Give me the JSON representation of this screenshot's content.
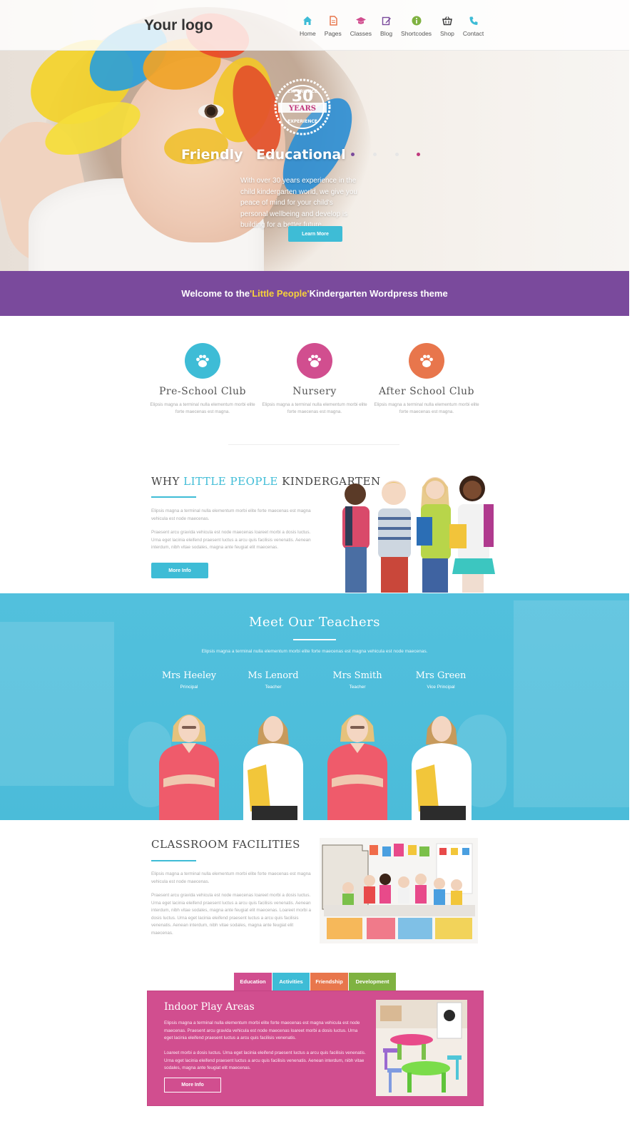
{
  "header": {
    "logo": "Your logo",
    "nav": [
      {
        "label": "Home",
        "icon": "home-icon",
        "color": "#3ebcd6"
      },
      {
        "label": "Pages",
        "icon": "document-icon",
        "color": "#e8764c"
      },
      {
        "label": "Classes",
        "icon": "graduation-cap-icon",
        "color": "#d14e8f"
      },
      {
        "label": "Blog",
        "icon": "edit-icon",
        "color": "#7a4a9c"
      },
      {
        "label": "Shortcodes",
        "icon": "info-icon",
        "color": "#7fb241"
      },
      {
        "label": "Shop",
        "icon": "basket-icon",
        "color": "#333333"
      },
      {
        "label": "Contact",
        "icon": "phone-icon",
        "color": "#3ebcd6"
      }
    ]
  },
  "hero": {
    "badge_number": "30",
    "badge_top": "EXPERIENCE",
    "badge_mid": "YEARS",
    "badge_bottom": "EXPERIENCE",
    "word_left": "Friendly",
    "word_right": "Educational",
    "text": "With over 30 years experience in the child kindergarten world, we give you peace of mind for your child's personal wellbeing and develop is building for a better future.",
    "button": "Learn More",
    "dot_colors": [
      "#7a4a9c",
      "#e6e6e6",
      "#e6e6e6",
      "#c0397d"
    ]
  },
  "welcome": {
    "prefix": "Welcome to the ",
    "highlight": "'Little People'",
    "suffix": " Kindergarten Wordpress theme"
  },
  "clubs": [
    {
      "title": "Pre-School Club",
      "color": "#3ebcd6",
      "icon": "paw-icon",
      "text": "Elipsis magna a terminal nulla elementum morbi elite forte maecenas est magna."
    },
    {
      "title": "Nursery",
      "color": "#d14e8f",
      "icon": "paw-icon",
      "text": "Elipsis magna a terminal nulla elementum morbi elite forte maecenas est magna."
    },
    {
      "title": "After School Club",
      "color": "#e8764c",
      "icon": "paw-icon",
      "text": "Elipsis magna a terminal nulla elementum morbi elite forte maecenas est magna."
    }
  ],
  "why": {
    "title_pre": "WHY ",
    "title_accent": "LITTLE PEOPLE",
    "title_post": " KINDERGARTEN",
    "p1": "Elipsis magna a terminal nulla elementum morbi elite forte maecenas est magna vehicula est node maecenas.",
    "p2": "Praesent arcu gravida vehicula est node maecenas loareet morbi a dosis luctus. Urna eget lacinia eleifend praesent luctus a arcu quis facilisis venenatis. Aenean interdum, nibh vitae sodales, magna ante feugiat elit maecenas.",
    "button": "More Info"
  },
  "teachers": {
    "title": "Meet Our Teachers",
    "subtitle": "Elipsis magna a terminal nulla elementum morbi elite forte maecenas est magna vehicula est node maecenas.",
    "list": [
      {
        "name": "Mrs Heeley",
        "role": "Principal"
      },
      {
        "name": "Ms Lenord",
        "role": "Teacher"
      },
      {
        "name": "Mrs Smith",
        "role": "Teacher"
      },
      {
        "name": "Mrs Green",
        "role": "Vice Principal"
      }
    ]
  },
  "classroom": {
    "title": "CLASSROOM FACILITIES",
    "p1": "Elipsis magna a terminal nulla elementum morbi elite forte maecenas est magna vehicula est node maecenas.",
    "p2": "Praesent arcu gravida vehicula est node maecenas loareet morbi a dosis luctus. Urna eget lacinia eleifend praesent luctus a arcu quis facilisis venenatis. Aenean interdum, nibh vitae sodales, magna ante feugiat elit maecenas. Loareet morbi a dosis luctus. Urna eget lacinia eleifend praesent luctus a arcu quis facilisis venenatis. Aenean interdum, nibh vitae sodales, magna ante feugiat elit maecenas."
  },
  "tabs": {
    "items": [
      {
        "label": "Education",
        "color": "#d14e8f"
      },
      {
        "label": "Activities",
        "color": "#3ebcd6"
      },
      {
        "label": "Friendship",
        "color": "#e8764c"
      },
      {
        "label": "Development",
        "color": "#7fb241"
      }
    ],
    "panel_title": "Indoor Play Areas",
    "panel_p1": "Elipsis magna a terminal nulla elementum morbi elite forte maecenas est magna vehicula est node maecenas. Praesent arcu gravida vehicula est node maecenas loareet morbi a dosis luctus. Urna eget lacinia eleifend praesent luctus a arcu quis facilisis venenatis.",
    "panel_p2": "Loareet morbi a dosis luctus. Urna eget lacinia eleifend praesent luctus a arcu quis facilisis venenatis. Urna eget lacinia eleifend praesent luctus a arcu quis facilisis venenatis. Aenean interdum, nibh vitae sodales, magna ante feugiat elit maecenas.",
    "panel_button": "More Info"
  }
}
